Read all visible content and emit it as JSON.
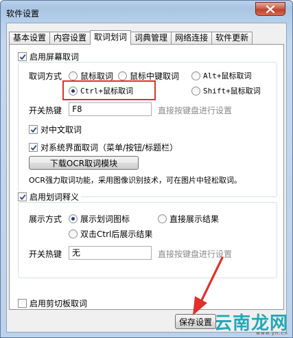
{
  "window": {
    "title": "软件设置"
  },
  "tabs": [
    {
      "label": "基本设置",
      "active": false
    },
    {
      "label": "内容设置",
      "active": false
    },
    {
      "label": "取词划词",
      "active": true
    },
    {
      "label": "词典管理",
      "active": false
    },
    {
      "label": "网络连接",
      "active": false
    },
    {
      "label": "软件更新",
      "active": false
    }
  ],
  "screen_capture": {
    "enable_label": "启用屏幕取词",
    "enabled": true,
    "method_label": "取词方式",
    "methods": [
      {
        "label": "鼠标取词",
        "selected": false
      },
      {
        "label": "鼠标中键取词",
        "selected": false
      },
      {
        "label": "Alt+鼠标取词",
        "selected": false
      },
      {
        "label": "Ctrl+鼠标取词",
        "selected": true
      },
      {
        "label": "Shift+鼠标取词",
        "selected": false
      }
    ],
    "hotkey_label": "开关热键",
    "hotkey_value": "F8",
    "hotkey_hint": "直接按键盘进行设置",
    "chinese_label": "对中文取词",
    "chinese_checked": true,
    "ui_label": "对系统界面取词（菜单/按钮/标题栏）",
    "ui_checked": true,
    "ocr_button": "下载OCR取词模块",
    "ocr_desc": "OCR强力取词功能，采用图像识别技术，可在图片中轻松取词。"
  },
  "selection": {
    "enable_label": "启用划词释义",
    "enabled": true,
    "display_label": "展示方式",
    "modes": [
      {
        "label": "展示划词图标",
        "selected": true
      },
      {
        "label": "直接展示结果",
        "selected": false
      },
      {
        "label": "双击Ctrl后展示结果",
        "selected": false
      }
    ],
    "hotkey_label": "开关热键",
    "hotkey_value": "无",
    "hotkey_hint": "直接按键盘进行设置"
  },
  "clipboard": {
    "enable_label": "启用剪切板取词",
    "enabled": false
  },
  "footer": {
    "save_label": "保存设置"
  },
  "watermark": {
    "text": "云南龙网",
    "sub": "www.yn.cn"
  },
  "colors": {
    "highlight": "#e0302a",
    "arrow": "#e0302a",
    "check": "#2b4a7c"
  }
}
